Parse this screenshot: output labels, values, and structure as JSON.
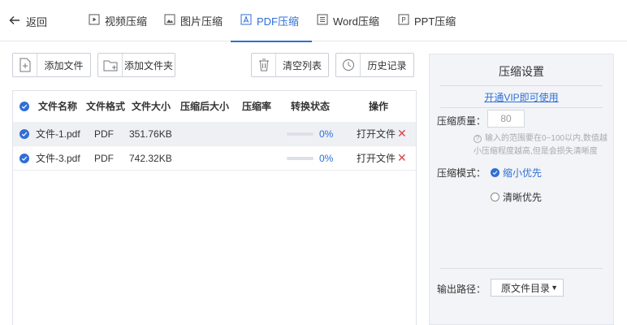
{
  "nav": {
    "back_label": "返回",
    "tabs": [
      {
        "label": "视频压缩",
        "active": false
      },
      {
        "label": "图片压缩",
        "active": false
      },
      {
        "label": "PDF压缩",
        "active": true
      },
      {
        "label": "Word压缩",
        "active": false
      },
      {
        "label": "PPT压缩",
        "active": false
      }
    ]
  },
  "toolbar": {
    "add_file": "添加文件",
    "add_folder": "添加文件夹",
    "clear_list": "清空列表",
    "history": "历史记录"
  },
  "table": {
    "columns": [
      "文件名称",
      "文件格式",
      "文件大小",
      "压缩后大小",
      "压缩率",
      "转换状态",
      "操作"
    ],
    "rows": [
      {
        "name": "文件-1.pdf",
        "format": "PDF",
        "size": "351.76KB",
        "compressed": "",
        "ratio": "",
        "progress": 0,
        "progress_label": "0%",
        "open": "打开文件",
        "selected": true
      },
      {
        "name": "文件-3.pdf",
        "format": "PDF",
        "size": "742.32KB",
        "compressed": "",
        "ratio": "",
        "progress": 0,
        "progress_label": "0%",
        "open": "打开文件",
        "selected": false
      }
    ]
  },
  "settings": {
    "title": "压缩设置",
    "vip_link": "开通VIP即可使用",
    "quality_label": "压缩质量：",
    "quality_value": "80",
    "hint_line1": "输入的范围要在0~100以内,数值越",
    "hint_line2": "小压缩程度越高,但是会损失清晰度",
    "mode_label": "压缩模式：",
    "mode_options": [
      {
        "label": "缩小优先",
        "selected": true
      },
      {
        "label": "清晰优先",
        "selected": false
      }
    ],
    "output_label": "输出路径：",
    "output_value": "原文件目录"
  },
  "colors": {
    "accent": "#2f6fd6",
    "delete": "#d9434a"
  }
}
